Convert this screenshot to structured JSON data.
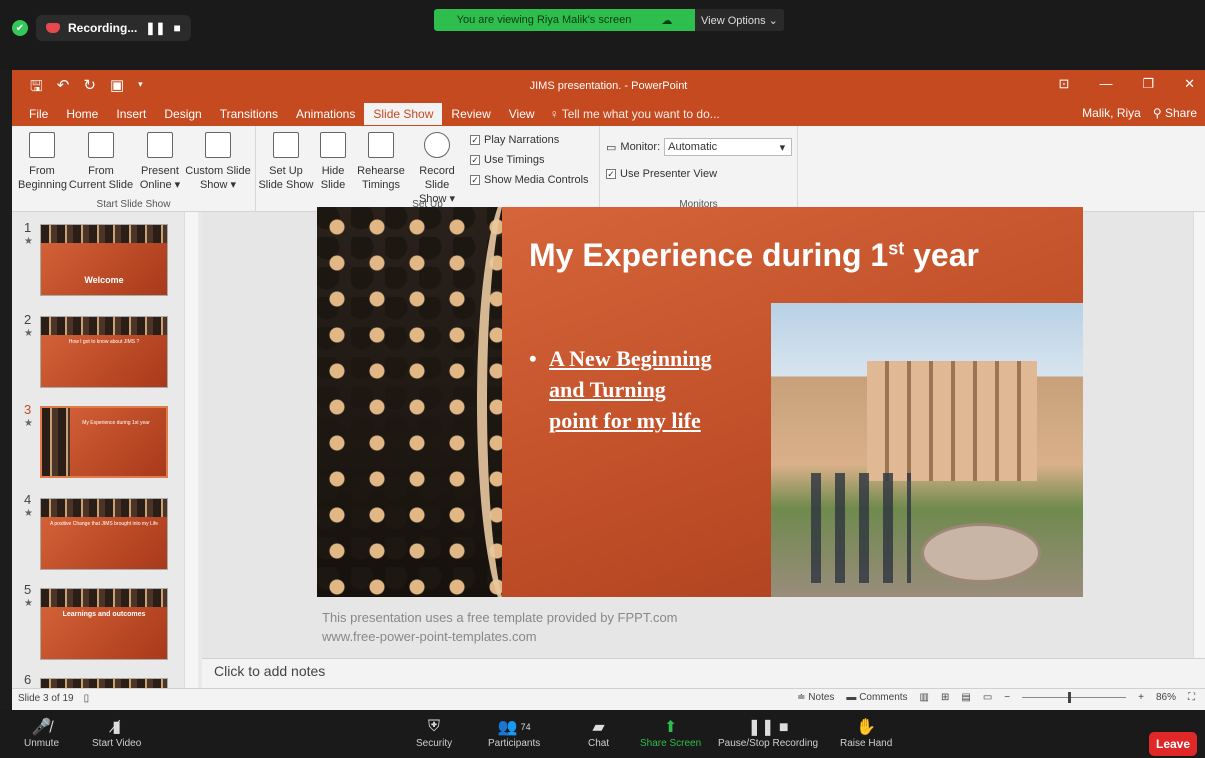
{
  "zoom": {
    "recording_label": "Recording...",
    "viewing_banner": "You are viewing Riya Malik's screen",
    "view_options": "View Options ⌄",
    "bottom": {
      "unmute": "Unmute",
      "start_video": "Start Video",
      "security": "Security",
      "participants": "Participants",
      "participant_count": "74",
      "chat": "Chat",
      "share_screen": "Share Screen",
      "pause_stop": "Pause/Stop Recording",
      "raise_hand": "Raise Hand",
      "leave": "Leave"
    }
  },
  "ppt": {
    "doc_title": "JIMS presentation. - PowerPoint",
    "user": "Malik, Riya",
    "share": "Share",
    "tabs": [
      "File",
      "Home",
      "Insert",
      "Design",
      "Transitions",
      "Animations",
      "Slide Show",
      "Review",
      "View"
    ],
    "active_tab": "Slide Show",
    "tell_me": "Tell me what you want to do...",
    "ribbon": {
      "from_beginning": [
        "From",
        "Beginning"
      ],
      "from_current": [
        "From",
        "Current Slide"
      ],
      "present_online": [
        "Present",
        "Online ▾"
      ],
      "custom_show": [
        "Custom Slide",
        "Show ▾"
      ],
      "group_start": "Start Slide Show",
      "set_up": [
        "Set Up",
        "Slide Show"
      ],
      "hide_slide": [
        "Hide",
        "Slide"
      ],
      "rehearse": [
        "Rehearse",
        "Timings"
      ],
      "record_show": [
        "Record Slide",
        "Show ▾"
      ],
      "play_narrations": "Play Narrations",
      "use_timings": "Use Timings",
      "show_media": "Show Media Controls",
      "group_setup": "Set Up",
      "monitor_label": "Monitor:",
      "monitor_value": "Automatic",
      "presenter_view": "Use Presenter View",
      "group_monitors": "Monitors"
    },
    "thumbnails": [
      {
        "num": "1",
        "label": "Welcome"
      },
      {
        "num": "2",
        "label": "How I got to know about JIMS ?"
      },
      {
        "num": "3",
        "label": "My Experience during 1st year"
      },
      {
        "num": "4",
        "label": "A positive Change that JIMS brought into my Life"
      },
      {
        "num": "5",
        "label": "Learnings and outcomes"
      },
      {
        "num": "6",
        "label": ""
      }
    ],
    "slide": {
      "title": "My Experience during 1",
      "title_sup": "st",
      "title_end": " year",
      "bullet": "A New Beginning and Turning point for my life",
      "template_note_1": "This presentation uses a free template provided by FPPT.com",
      "template_note_2": "www.free-power-point-templates.com"
    },
    "notes_placeholder": "Click to add notes",
    "status": {
      "slide_info": "Slide 3 of 19",
      "notes": "Notes",
      "comments": "Comments",
      "zoom": "86%"
    }
  }
}
